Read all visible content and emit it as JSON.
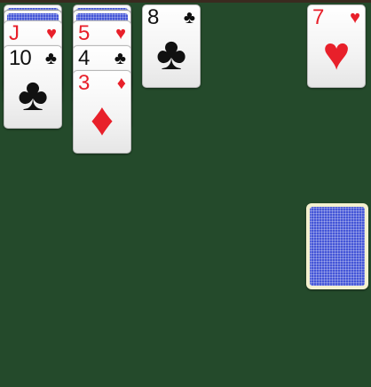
{
  "tableau": [
    {
      "hidden_count": 2,
      "cards": [
        {
          "rank": "J",
          "suit": "♥",
          "color": "red"
        },
        {
          "rank": "10",
          "suit": "♣",
          "color": "black"
        }
      ]
    },
    {
      "hidden_count": 2,
      "cards": [
        {
          "rank": "5",
          "suit": "♥",
          "color": "red"
        },
        {
          "rank": "4",
          "suit": "♣",
          "color": "black"
        },
        {
          "rank": "3",
          "suit": "♦",
          "color": "red"
        }
      ]
    },
    {
      "hidden_count": 0,
      "cards": [
        {
          "rank": "8",
          "suit": "♣",
          "color": "black"
        }
      ]
    }
  ],
  "waste_card": {
    "rank": "7",
    "suit": "♥",
    "color": "red"
  },
  "stock": {
    "face": "down"
  },
  "colors": {
    "felt": "#244a2b",
    "card_back": "#2b3fd2",
    "red_suit": "#e8202a",
    "black_suit": "#111111",
    "stock_border": "#f4f1cf"
  }
}
